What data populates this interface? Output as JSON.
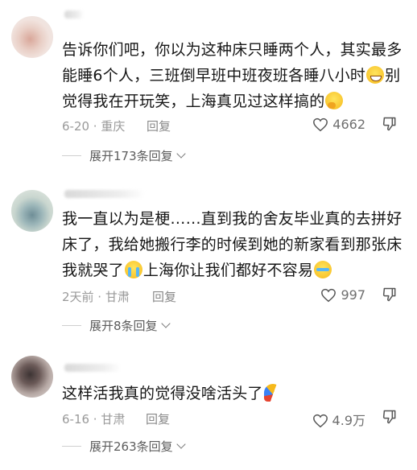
{
  "comments": [
    {
      "text": [
        "告诉你们吧，你以为这种床只睡两个人，其实最多",
        "能睡6个人，三班倒早班中班夜班各睡八小时",
        "别",
        "觉得我在开玩笑，上海真见过这样搞的"
      ],
      "time": "6-20 · 重庆",
      "reply": "回复",
      "likes": "4662",
      "expand": "展开173条回复"
    },
    {
      "text": [
        "我一直以为是梗……直到我的舍友毕业真的去拼好",
        "床了，我给她搬行李的时候到她的新家看到那张床",
        "我就哭了",
        "上海你让我们都好不容易"
      ],
      "time": "2天前 · 甘肃",
      "reply": "回复",
      "likes": "997",
      "expand": "展开8条回复"
    },
    {
      "text": [
        "这样活我真的觉得没啥活头了"
      ],
      "time": "6-16 · 甘肃",
      "reply": "回复",
      "likes": "4.9万",
      "expand": "展开263条回复"
    }
  ]
}
